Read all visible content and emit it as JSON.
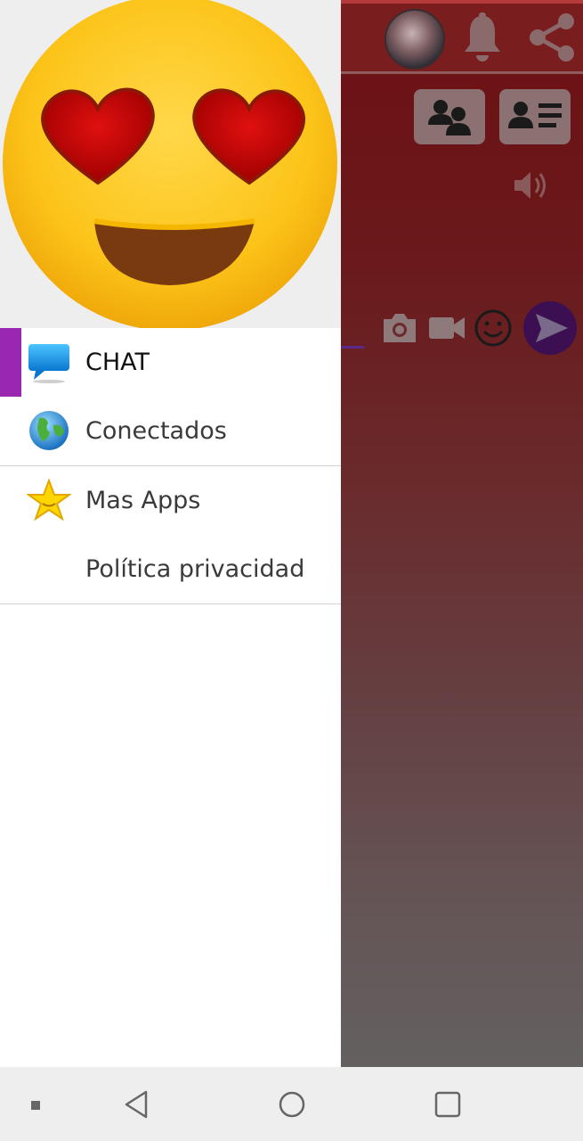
{
  "drawer": {
    "items": [
      {
        "label": "CHAT",
        "icon": "chat-bubble-icon",
        "active": true
      },
      {
        "label": "Conectados",
        "icon": "globe-icon",
        "active": false
      },
      {
        "label": "Mas Apps",
        "icon": "star-icon",
        "active": false
      },
      {
        "label": "Política privacidad",
        "icon": "",
        "active": false
      }
    ],
    "header_image": "heart-eyes-emoji"
  },
  "toolbar": {
    "icons": [
      "avatar",
      "bell-icon",
      "share-icon"
    ]
  },
  "background_actions": {
    "buttons": [
      "group-users-icon",
      "user-profile-card-icon",
      "volume-icon",
      "camera-icon",
      "video-icon",
      "emoji-smile-icon",
      "send-icon"
    ]
  },
  "nav": {
    "buttons": [
      "menu-dot",
      "back-icon",
      "home-icon",
      "recents-icon"
    ]
  },
  "colors": {
    "accent": "#9a27b0",
    "app_primary": "#7a1d1f",
    "send_button": "#3c0f52"
  }
}
